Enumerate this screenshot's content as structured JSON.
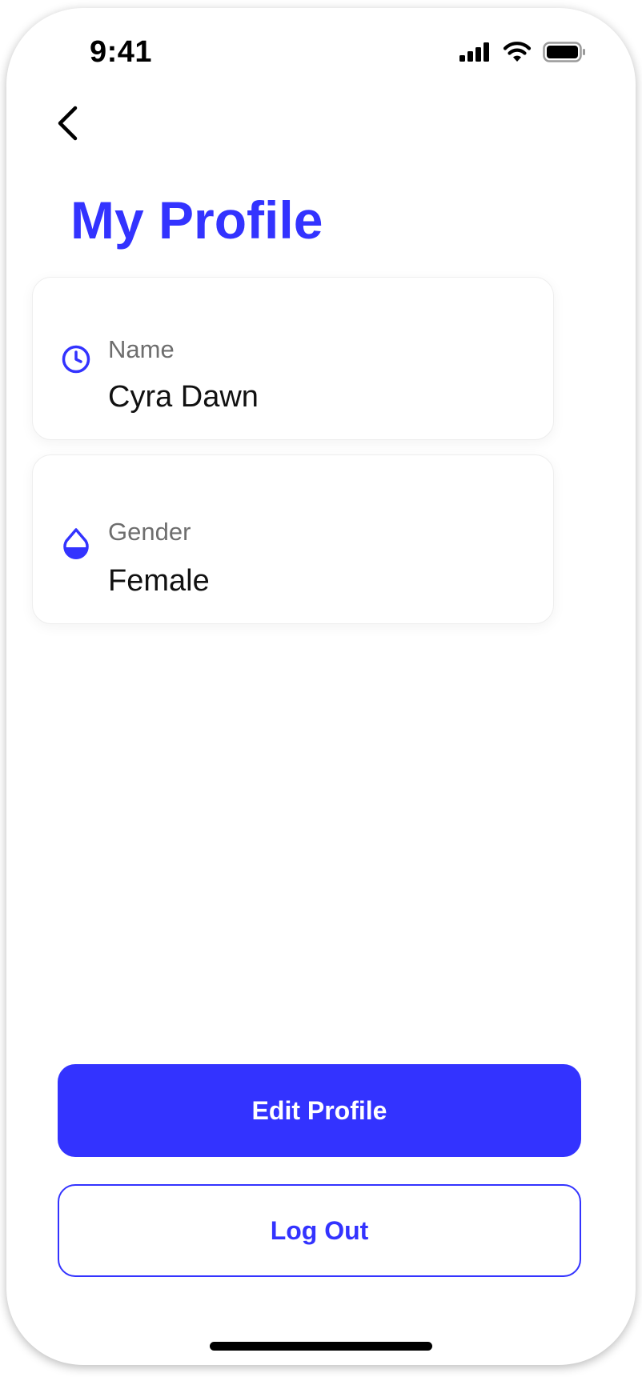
{
  "colors": {
    "accent": "#3333FF",
    "text_primary": "#111111",
    "text_secondary": "#6E6E6E"
  },
  "status_bar": {
    "time": "9:41",
    "icons": [
      "cellular-signal-icon",
      "wifi-icon",
      "battery-icon"
    ]
  },
  "nav": {
    "back_icon": "chevron-left-icon"
  },
  "page": {
    "title": "My Profile"
  },
  "profile_fields": [
    {
      "icon": "clock-icon",
      "label": "Name",
      "value": "Cyra Dawn"
    },
    {
      "icon": "droplet-icon",
      "label": "Gender",
      "value": "Female"
    }
  ],
  "actions": {
    "edit_label": "Edit Profile",
    "logout_label": "Log Out"
  }
}
